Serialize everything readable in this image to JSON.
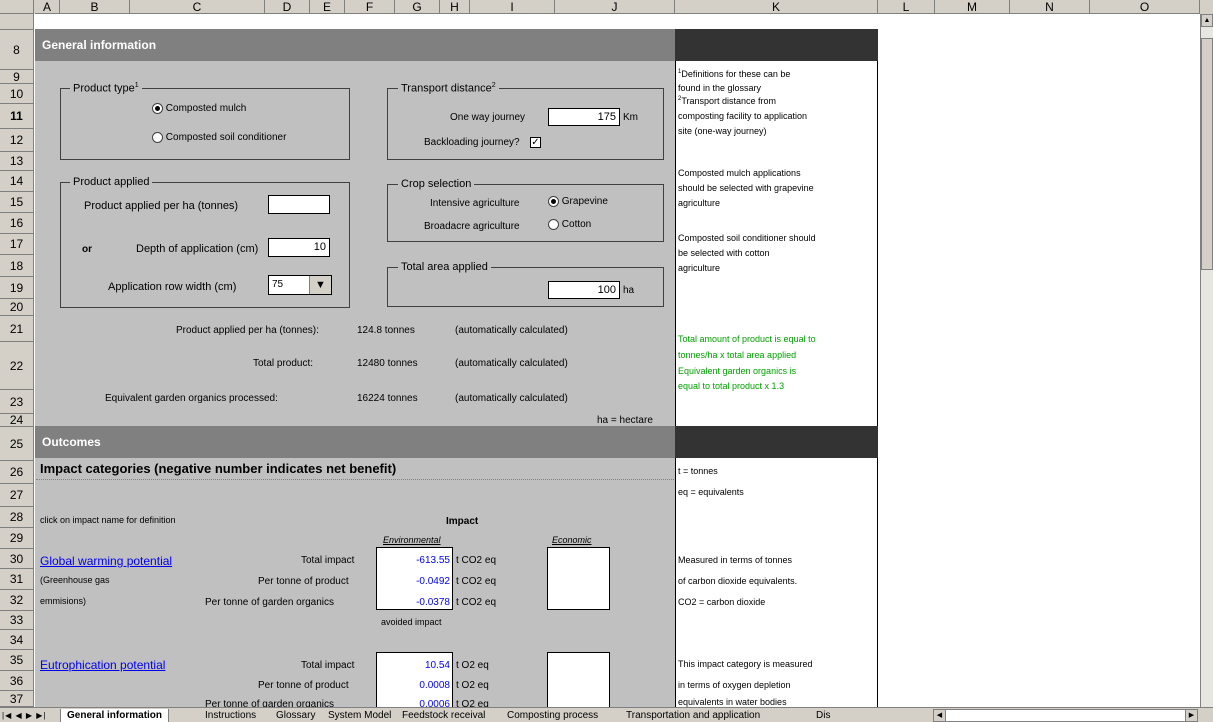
{
  "columns": [
    "A",
    "B",
    "C",
    "D",
    "E",
    "F",
    "G",
    "H",
    "I",
    "J",
    "K",
    "L",
    "M",
    "N",
    "O"
  ],
  "rows": [
    "8",
    "9",
    "10",
    "11",
    "12",
    "13",
    "14",
    "15",
    "16",
    "17",
    "18",
    "19",
    "20",
    "21",
    "22",
    "23",
    "24",
    "25",
    "26",
    "27",
    "28",
    "29",
    "30",
    "31",
    "32",
    "33",
    "34",
    "35",
    "36",
    "37"
  ],
  "general": {
    "header": "General information",
    "product_type": {
      "title": "Product type",
      "sup": "1",
      "opt1": "Composted mulch",
      "opt2": "Composted soil conditioner"
    },
    "transport": {
      "title": "Transport distance",
      "sup": "2",
      "label": "One way journey",
      "value": "175",
      "unit": "Km",
      "backload_label": "Backloading journey?",
      "backload_mark": "✓"
    },
    "product_applied": {
      "title": "Product applied",
      "per_ha_label": "Product applied per ha (tonnes)",
      "per_ha_value": "",
      "or_label": "or",
      "depth_label": "Depth of application (cm)",
      "depth_value": "10",
      "row_width_label": "Application row width (cm)",
      "row_width_value": "75"
    },
    "crop": {
      "title": "Crop selection",
      "intensive_label": "Intensive agriculture",
      "intensive_opt": "Grapevine",
      "broadacre_label": "Broadacre agriculture",
      "broadacre_opt": "Cotton"
    },
    "area": {
      "title": "Total area applied",
      "value": "100",
      "unit": "ha"
    },
    "calc": [
      {
        "label": "Product applied per ha (tonnes):",
        "value": "124.8 tonnes",
        "note": "(automatically calculated)"
      },
      {
        "label": "Total product:",
        "value": "12480 tonnes",
        "note": "(automatically calculated)"
      },
      {
        "label": "Equivalent garden organics processed:",
        "value": "16224 tonnes",
        "note": "(automatically calculated)"
      }
    ],
    "ha_note": "ha = hectare"
  },
  "notes_k": {
    "n1a": "Definitions for these can be",
    "n1b": "found in the glossary",
    "n2a": "Transport distance from",
    "n2b": "composting facility to application",
    "n2c": "site (one-way journey)",
    "m1": "Composted mulch applications",
    "m2": "should be selected with grapevine",
    "m3": "agriculture",
    "s1": "Composted soil conditioner should",
    "s2": "be selected with cotton",
    "s3": "agriculture",
    "g1": "Total amount of product is equal to",
    "g2": "tonnes/ha x total area applied",
    "g3": "Equivalent garden organics is",
    "g4": "equal to total product x 1.3",
    "t1": "t = tonnes",
    "t2": "eq = equivalents",
    "w1": "Measured in terms of tonnes",
    "w2": "of carbon dioxide equivalents.",
    "w3": "CO2 = carbon dioxide",
    "e1": "This impact category is measured",
    "e2": "in terms of oxygen depletion",
    "e3": "equivalents in water bodies"
  },
  "outcomes": {
    "header": "Outcomes",
    "impact_title": "Impact categories (negative number indicates net benefit)",
    "click_note": "click on impact name for definition",
    "impact_head": "Impact",
    "env_head": "Environmental",
    "eco_head": "Economic",
    "gwp": {
      "name": "Global warming potential",
      "sub1": "(Greenhouse gas",
      "sub2": "emmisions)",
      "rows": [
        {
          "label": "Total impact",
          "value": "-613.55",
          "unit": "t CO2 eq"
        },
        {
          "label": "Per tonne of product",
          "value": "-0.0492",
          "unit": "t CO2 eq"
        },
        {
          "label": "Per tonne of garden organics",
          "value": "-0.0378",
          "unit": "t CO2 eq"
        }
      ],
      "avoided": "avoided impact"
    },
    "eut": {
      "name": "Eutrophication potential",
      "rows": [
        {
          "label": "Total impact",
          "value": "10.54",
          "unit": "t O2 eq"
        },
        {
          "label": "Per tonne of product",
          "value": "0.0008",
          "unit": "t O2 eq"
        },
        {
          "label": "Per tonne of garden organics",
          "value": "0.0006",
          "unit": "t O2 eq"
        }
      ]
    }
  },
  "tabs": [
    "General information",
    "Instructions",
    "Glossary",
    "System Model",
    "Feedstock receival",
    "Composting process",
    "Transportation and application",
    "Dis"
  ],
  "colors": {
    "header_bg": "#808080",
    "dark_bg": "#333333",
    "sheet_bg": "#c0c0c0",
    "link": "#0000ee",
    "green_note": "#00a000"
  }
}
